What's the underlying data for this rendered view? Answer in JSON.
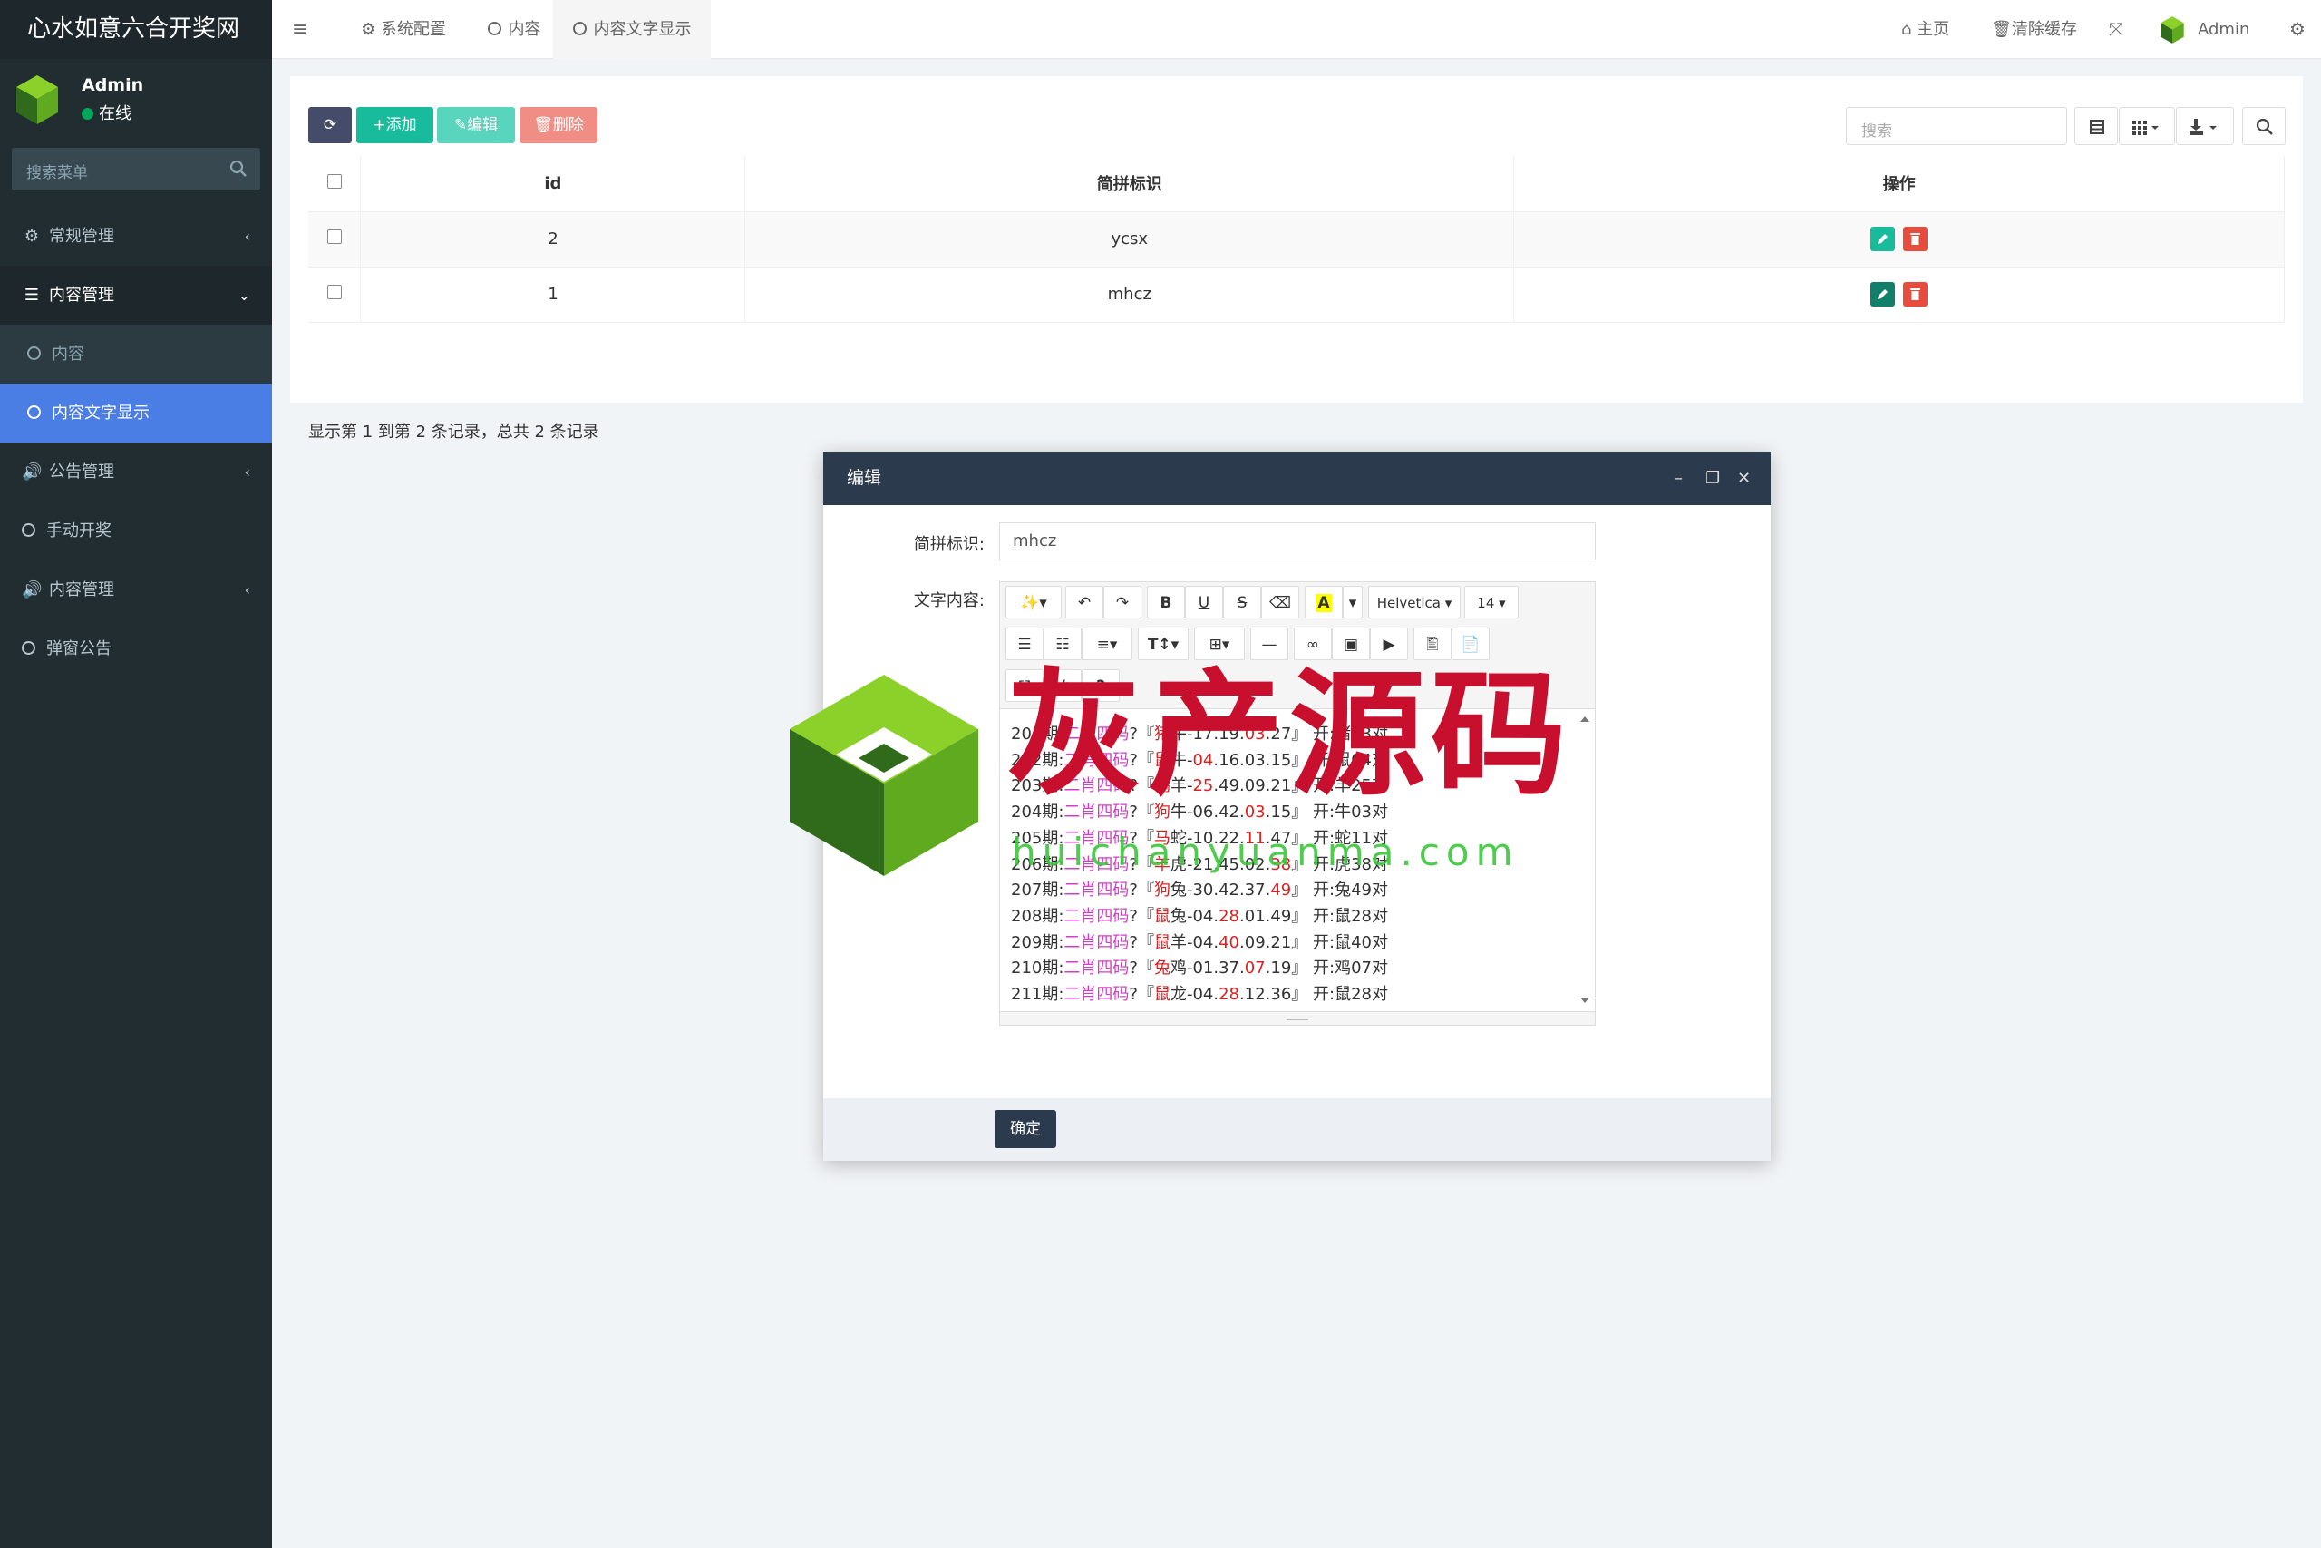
{
  "brand": {
    "title": "心水如意六合开奖网"
  },
  "user": {
    "name": "Admin",
    "status": "在线"
  },
  "sidebar_search": {
    "placeholder": "搜索菜单"
  },
  "menu": [
    {
      "label": "常规管理"
    },
    {
      "label": "内容管理"
    },
    {
      "label": "内容"
    },
    {
      "label": "内容文字显示"
    },
    {
      "label": "公告管理"
    },
    {
      "label": "手动开奖"
    },
    {
      "label": "内容管理"
    },
    {
      "label": "弹窗公告"
    }
  ],
  "tabs": [
    {
      "label": "系统配置"
    },
    {
      "label": "内容"
    },
    {
      "label": "内容文字显示"
    }
  ],
  "topbar_right": {
    "home": "主页",
    "clear_cache": "清除缓存",
    "admin": "Admin"
  },
  "toolbar": {
    "add": "添加",
    "edit": "编辑",
    "delete": "删除",
    "search_placeholder": "搜索"
  },
  "table": {
    "headers": [
      "id",
      "简拼标识",
      "操作"
    ],
    "rows": [
      {
        "id": "2",
        "code": "ycsx"
      },
      {
        "id": "1",
        "code": "mhcz"
      }
    ],
    "summary": "显示第 1 到第 2 条记录，总共 2 条记录"
  },
  "modal": {
    "title": "编辑",
    "field_code_label": "简拼标识:",
    "field_code_value": "mhcz",
    "field_content_label": "文字内容:",
    "font_name": "Helvetica",
    "font_size": "14",
    "ok": "确定",
    "lines": [
      {
        "period": "201期:",
        "tag": "二肖四码",
        "q": "?『",
        "z1": "猪",
        "z2": "牛",
        "nums_a": "-17.19.",
        "hl": "03",
        "nums_b": ".27』",
        "result": "开:猪03对"
      },
      {
        "period": "202期:",
        "tag": "二肖四码",
        "q": "?『",
        "z1": "鼠",
        "z2": "牛",
        "nums_a": "-",
        "hl": "04",
        "nums_b": ".16.03.15』",
        "result": "开:鼠04对"
      },
      {
        "period": "203期:",
        "tag": "二肖四码",
        "q": "?『",
        "z1": "鸡",
        "z2": "羊",
        "nums_a": "-",
        "hl": "25",
        "nums_b": ".49.09.21』",
        "result": "开:羊25对"
      },
      {
        "period": "204期:",
        "tag": "二肖四码",
        "q": "?『",
        "z1": "狗",
        "z2": "牛",
        "nums_a": "-06.42.",
        "hl": "03",
        "nums_b": ".15』",
        "result": "开:牛03对"
      },
      {
        "period": "205期:",
        "tag": "二肖四码",
        "q": "?『",
        "z1": "马",
        "z2": "蛇",
        "nums_a": "-10.22.",
        "hl": "11",
        "nums_b": ".47』",
        "result": "开:蛇11对"
      },
      {
        "period": "206期:",
        "tag": "二肖四码",
        "q": "?『",
        "z1": "羊",
        "z2": "虎",
        "nums_a": "-21.45.02.",
        "hl": "38",
        "nums_b": "』",
        "result": "开:虎38对"
      },
      {
        "period": "207期:",
        "tag": "二肖四码",
        "q": "?『",
        "z1": "狗",
        "z2": "兔",
        "nums_a": "-30.42.37.",
        "hl": "49",
        "nums_b": "』",
        "result": "开:兔49对"
      },
      {
        "period": "208期:",
        "tag": "二肖四码",
        "q": "?『",
        "z1": "鼠",
        "z2": "兔",
        "nums_a": "-04.",
        "hl": "28",
        "nums_b": ".01.49』",
        "result": "开:鼠28对"
      },
      {
        "period": "209期:",
        "tag": "二肖四码",
        "q": "?『",
        "z1": "鼠",
        "z2": "羊",
        "nums_a": "-04.",
        "hl": "40",
        "nums_b": ".09.21』",
        "result": "开:鼠40对"
      },
      {
        "period": "210期:",
        "tag": "二肖四码",
        "q": "?『",
        "z1": "兔",
        "z2": "鸡",
        "nums_a": "-01.37.",
        "hl": "07",
        "nums_b": ".19』",
        "result": "开:鸡07对"
      },
      {
        "period": "211期:",
        "tag": "二肖四码",
        "q": "?『",
        "z1": "鼠",
        "z2": "龙",
        "nums_a": "-04.",
        "hl": "28",
        "nums_b": ".12.36』",
        "result": "开:鼠28对"
      }
    ]
  },
  "watermark": {
    "text": "灰产源码",
    "url": "huichanyuanma.com"
  },
  "colors": {
    "sidebar_bg": "#222d32",
    "active_menu": "#4a7ee5",
    "add_btn": "#18bc9c",
    "edit_btn": "#59d4bd",
    "delete_btn": "#f08e85",
    "refresh_btn": "#444c69",
    "modal_header": "#2c3a4e"
  }
}
